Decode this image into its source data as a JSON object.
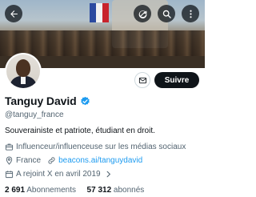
{
  "header": {
    "back_icon": "arrow-left-icon",
    "refresh_icon": "refresh-icon",
    "search_icon": "search-icon",
    "more_icon": "more-vertical-icon"
  },
  "profile": {
    "name": "Tanguy David",
    "handle": "@tanguy_france",
    "verified": true,
    "bio": "Souverainiste et patriote, étudiant en droit.",
    "category": "Influenceur/influenceuse sur les médias sociaux",
    "location": "France",
    "website": "beacons.ai/tanguydavid",
    "joined": "A rejoint X en avril 2019"
  },
  "actions": {
    "follow_label": "Suivre",
    "message_icon": "envelope-icon"
  },
  "stats": {
    "following_count": "2 691",
    "following_label": "Abonnements",
    "followers_count": "57 312",
    "followers_label": "abonnés"
  },
  "colors": {
    "accent": "#1d9bf0",
    "text": "#0f1419",
    "muted": "#536471"
  }
}
